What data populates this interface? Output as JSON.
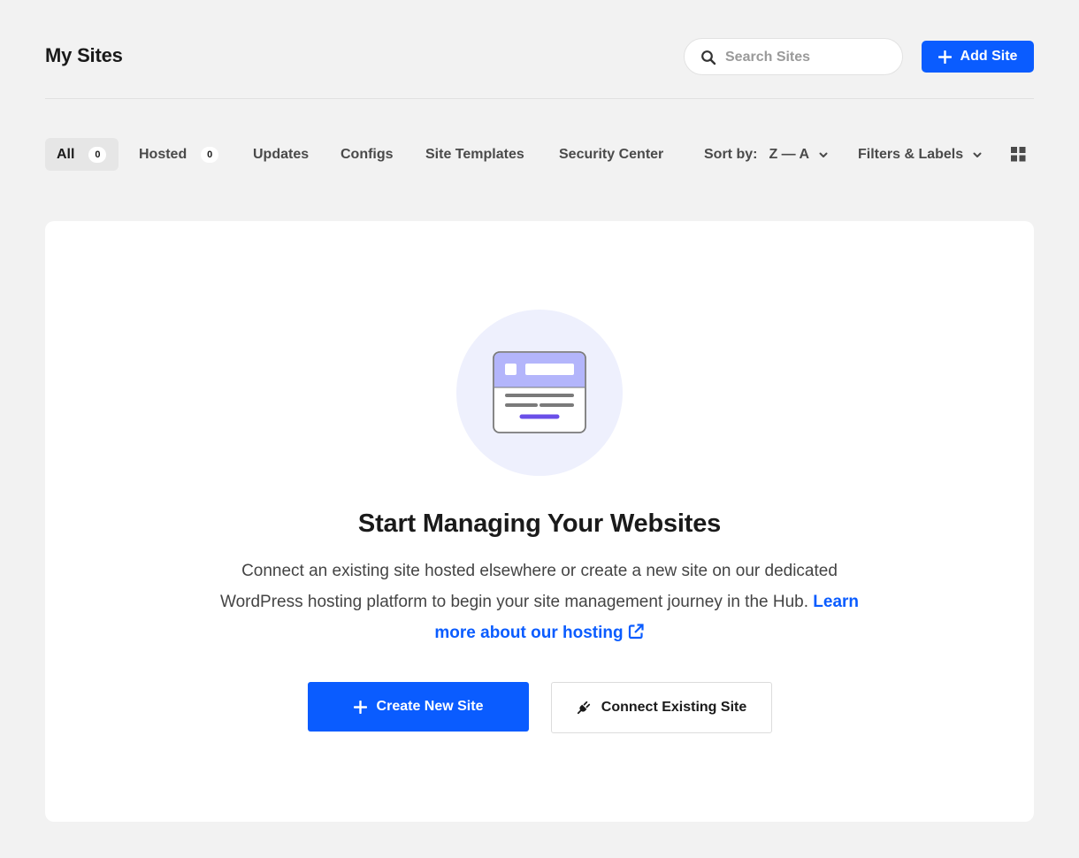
{
  "header": {
    "title": "My Sites",
    "search_placeholder": "Search Sites",
    "add_site_label": "Add Site"
  },
  "tabs": [
    {
      "label": "All",
      "count": "0",
      "active": true
    },
    {
      "label": "Hosted",
      "count": "0",
      "active": false
    },
    {
      "label": "Updates"
    },
    {
      "label": "Configs"
    },
    {
      "label": "Site Templates"
    },
    {
      "label": "Security Center"
    }
  ],
  "sort": {
    "label": "Sort by:",
    "value": "Z — A"
  },
  "filters": {
    "label": "Filters & Labels"
  },
  "empty_state": {
    "title": "Start Managing Your Websites",
    "description": "Connect an existing site hosted elsewhere or create a new site on our dedicated WordPress hosting platform to begin your site management journey in the Hub.",
    "link_text": "Learn more about our hosting",
    "create_label": "Create New Site",
    "connect_label": "Connect Existing Site"
  },
  "colors": {
    "accent": "#0a5cff",
    "page_bg": "#f2f2f2",
    "illustration_circle": "#eef0fd",
    "illustration_header": "#b3b5fb",
    "illustration_bar": "#6a4fe8"
  },
  "icons": {
    "search": "search-icon",
    "add": "plus-icon",
    "sort_chevron": "chevron-down-icon",
    "grid": "grid-view-icon",
    "external": "external-link-icon",
    "plug": "plug-icon"
  }
}
